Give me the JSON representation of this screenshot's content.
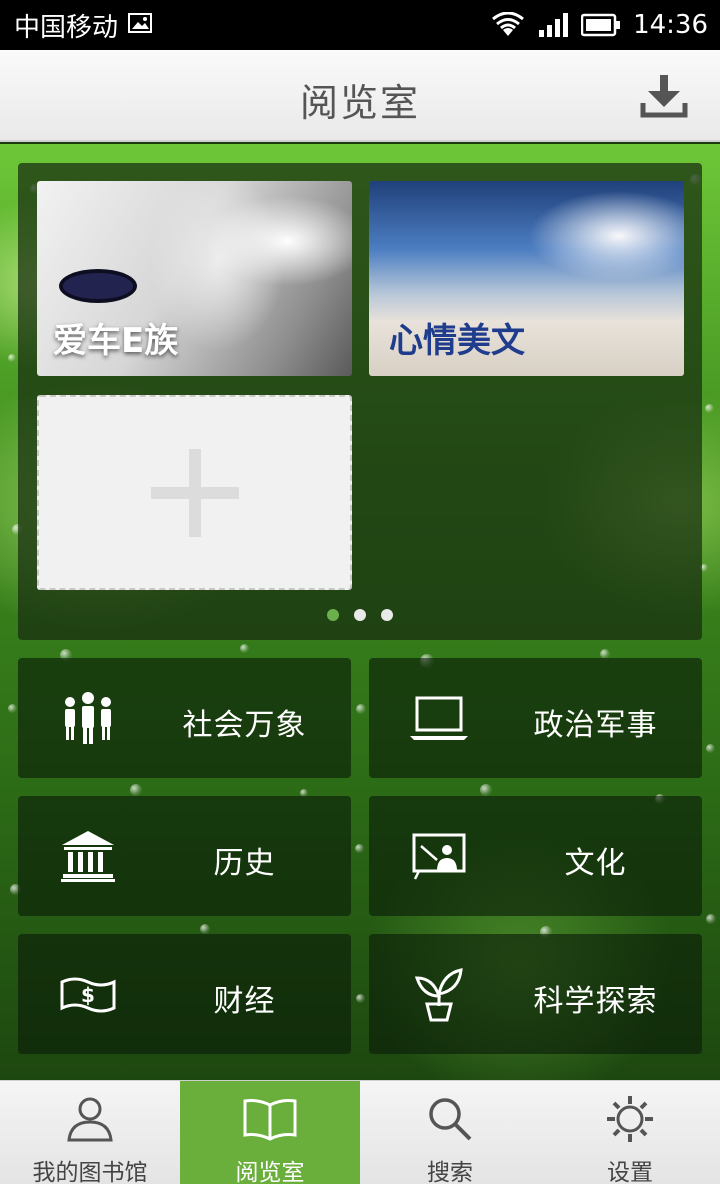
{
  "status_bar": {
    "carrier": "中国移动",
    "time": "14:36"
  },
  "header": {
    "title": "阅览室"
  },
  "featured": {
    "cards": [
      {
        "label": "爱车E族"
      },
      {
        "label": "心情美文"
      }
    ],
    "add_card_icon": "plus-icon",
    "page_count": 3,
    "active_page": 1
  },
  "categories": [
    {
      "label": "社会万象",
      "icon": "people-icon"
    },
    {
      "label": "政治军事",
      "icon": "laptop-icon"
    },
    {
      "label": "历史",
      "icon": "museum-icon"
    },
    {
      "label": "文化",
      "icon": "presentation-icon"
    },
    {
      "label": "财经",
      "icon": "money-icon"
    },
    {
      "label": "科学探索",
      "icon": "sprout-icon"
    }
  ],
  "bottom_nav": {
    "items": [
      {
        "label": "我的图书馆",
        "icon": "user-icon"
      },
      {
        "label": "阅览室",
        "icon": "book-icon"
      },
      {
        "label": "搜索",
        "icon": "search-icon"
      },
      {
        "label": "设置",
        "icon": "gear-icon"
      }
    ],
    "active_index": 1
  },
  "colors": {
    "accent": "#6aae3c",
    "page_dot_active": "#6ab04c",
    "card_label_blue": "#1f3d8c"
  }
}
